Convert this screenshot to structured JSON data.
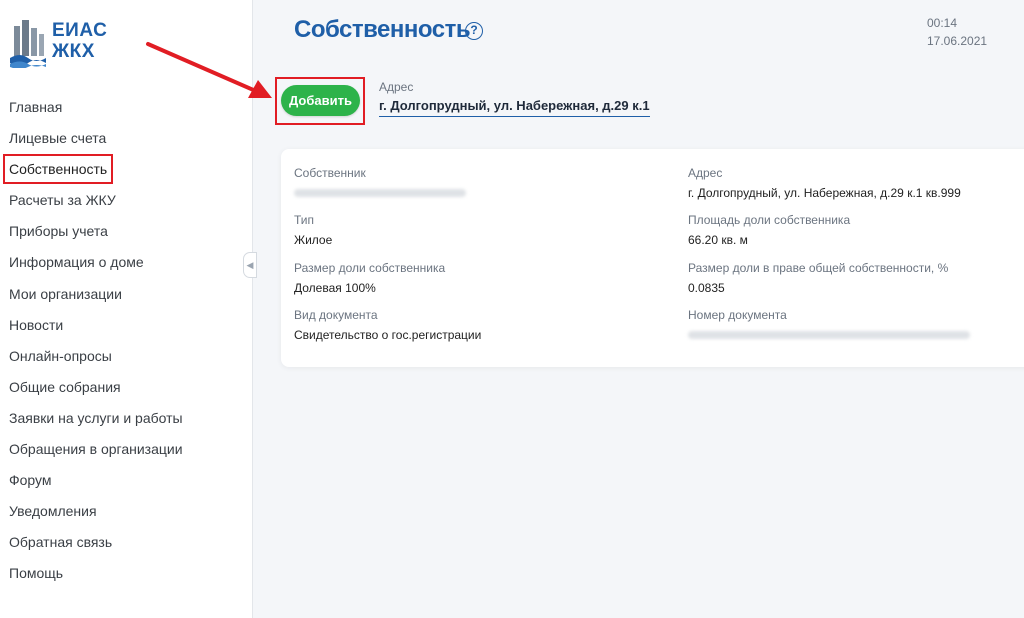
{
  "logo": {
    "line1": "ЕИАС",
    "line2": "ЖКХ"
  },
  "sidebar": {
    "items": [
      {
        "label": "Главная"
      },
      {
        "label": "Лицевые счета"
      },
      {
        "label": "Собственность"
      },
      {
        "label": "Расчеты за ЖКУ"
      },
      {
        "label": "Приборы учета"
      },
      {
        "label": "Информация о доме"
      },
      {
        "label": "Мои организации"
      },
      {
        "label": "Новости"
      },
      {
        "label": "Онлайн-опросы"
      },
      {
        "label": "Общие собрания"
      },
      {
        "label": "Заявки на услуги и работы"
      },
      {
        "label": "Обращения в организации"
      },
      {
        "label": "Форум"
      },
      {
        "label": "Уведомления"
      },
      {
        "label": "Обратная связь"
      },
      {
        "label": "Помощь"
      }
    ],
    "active": "Собственность"
  },
  "header": {
    "title": "Собственность",
    "help_glyph": "?",
    "time": "00:14",
    "date": "17.06.2021"
  },
  "toolbar": {
    "add_label": "Добавить",
    "address_label": "Адрес",
    "address_value": "г. Долгопрудный, ул. Набережная, д.29 к.1"
  },
  "property": {
    "owner_label": "Собственник",
    "address_label": "Адрес",
    "address_value": "г. Долгопрудный, ул. Набережная, д.29 к.1 кв.999",
    "type_label": "Тип",
    "type_value": "Жилое",
    "area_label": "Площадь доли собственника",
    "area_value": "66.20 кв. м",
    "share_label": "Размер доли собственника",
    "share_value": "Долевая 100%",
    "common_share_label": "Размер доли в праве общей собственности, %",
    "common_share_value": "0.0835",
    "doc_type_label": "Вид документа",
    "doc_type_value": "Свидетельство о гос.регистрации",
    "doc_number_label": "Номер документа"
  },
  "colors": {
    "accent": "#1f5fa8",
    "button": "#2db34a",
    "highlight": "#e11d24"
  }
}
